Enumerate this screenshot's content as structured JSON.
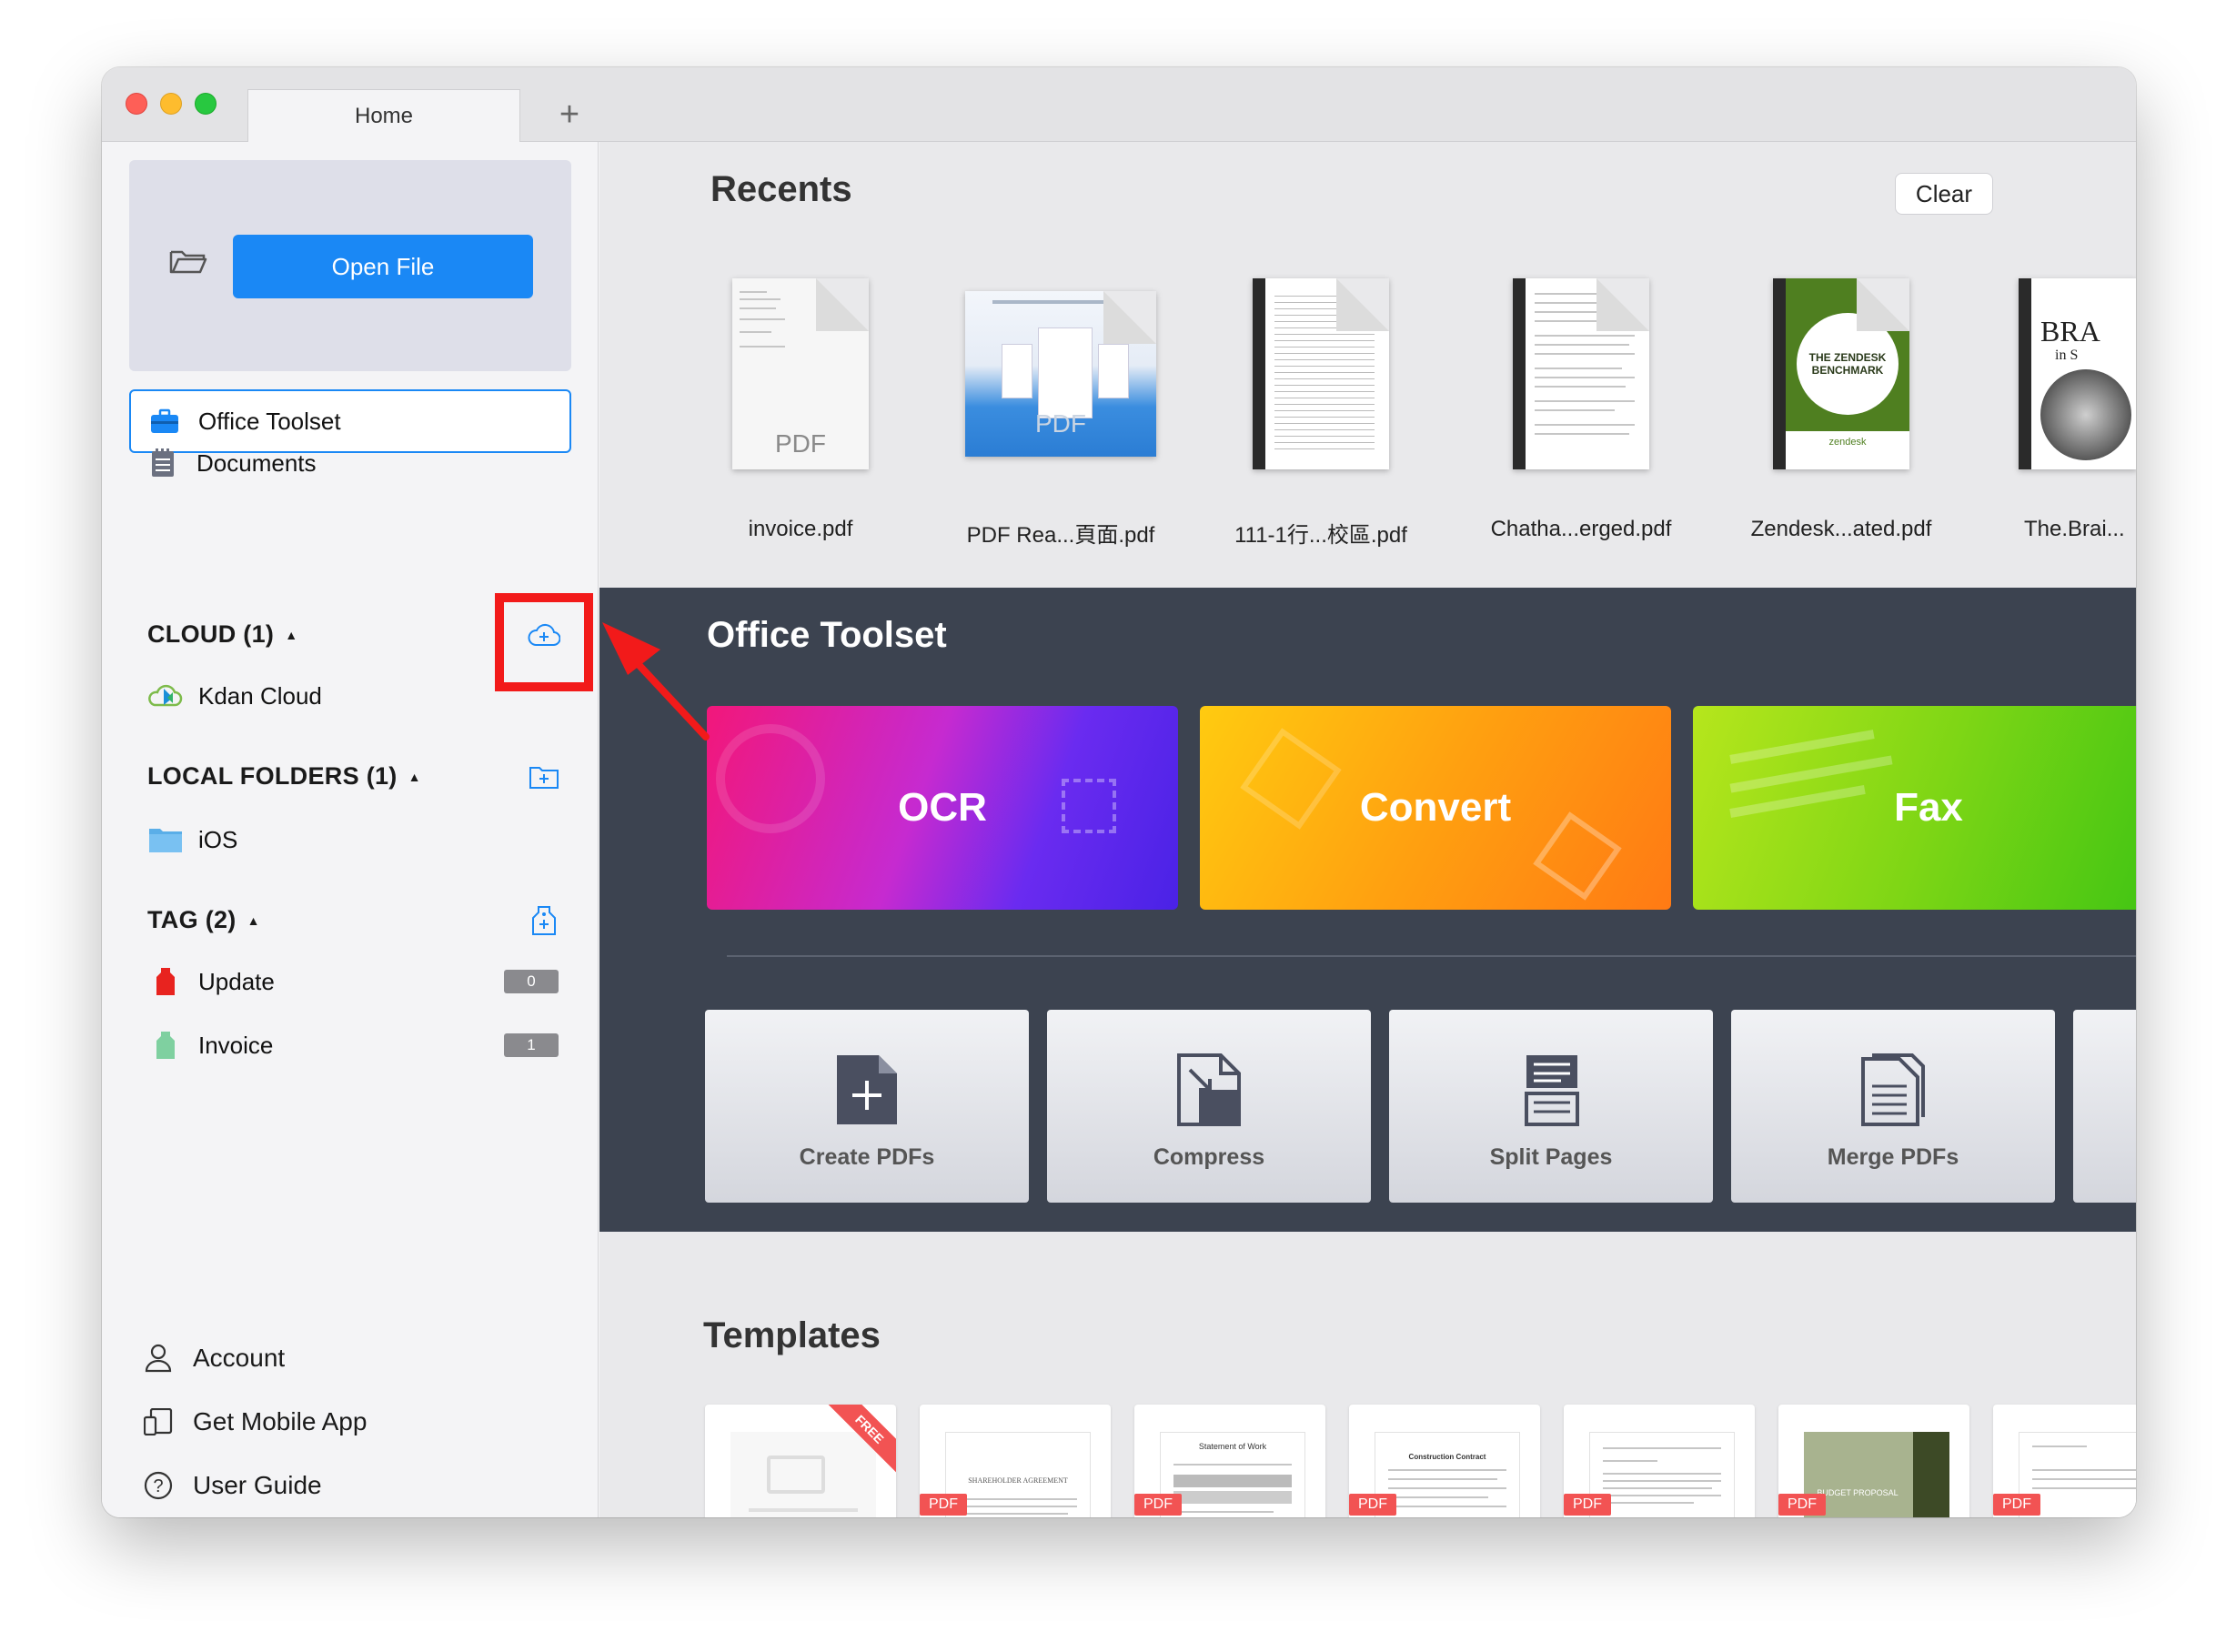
{
  "tab": {
    "title": "Home",
    "add": "+"
  },
  "sidebar": {
    "open_file": "Open File",
    "office_toolset": "Office Toolset",
    "documents": "Documents",
    "cloud": {
      "header": "CLOUD (1)",
      "items": [
        "Kdan Cloud"
      ]
    },
    "local_folders": {
      "header": "LOCAL FOLDERS (1)",
      "items": [
        "iOS"
      ]
    },
    "tag": {
      "header": "TAG (2)",
      "items": [
        {
          "label": "Update",
          "count": "0",
          "color": "#e8231f"
        },
        {
          "label": "Invoice",
          "count": "1",
          "color": "#7fd0a0"
        }
      ]
    },
    "caret": "▲",
    "bottom": {
      "account": "Account",
      "mobile_app": "Get Mobile App",
      "user_guide": "User Guide"
    }
  },
  "recents": {
    "title": "Recents",
    "clear": "Clear",
    "pdf_placeholder": "PDF",
    "files": [
      "invoice.pdf",
      "PDF Rea...頁面.pdf",
      "111-1行...校區.pdf",
      "Chatha...erged.pdf",
      "Zendesk...ated.pdf",
      "The.Brai..."
    ],
    "zendesk_cover": "THE ZENDESK BENCHMARK",
    "zendesk_brand": "zendesk",
    "brain_cover_title": "BRA",
    "brain_cover_sub": "in S"
  },
  "toolset": {
    "title": "Office Toolset",
    "big": [
      "OCR",
      "Convert",
      "Fax"
    ],
    "small": [
      "Create PDFs",
      "Compress",
      "Split Pages",
      "Merge PDFs"
    ]
  },
  "templates": {
    "title": "Templates",
    "free_label": "FREE",
    "pdf_label": "PDF",
    "doc_titles": [
      "SHAREHOLDER AGREEMENT",
      "Statement of Work",
      "Construction Contract",
      "BUDGET PROPOSAL"
    ]
  },
  "colors": {
    "accent": "#1a88f5",
    "highlight": "#f21a1a",
    "toolset_bg": "#3c4350"
  }
}
